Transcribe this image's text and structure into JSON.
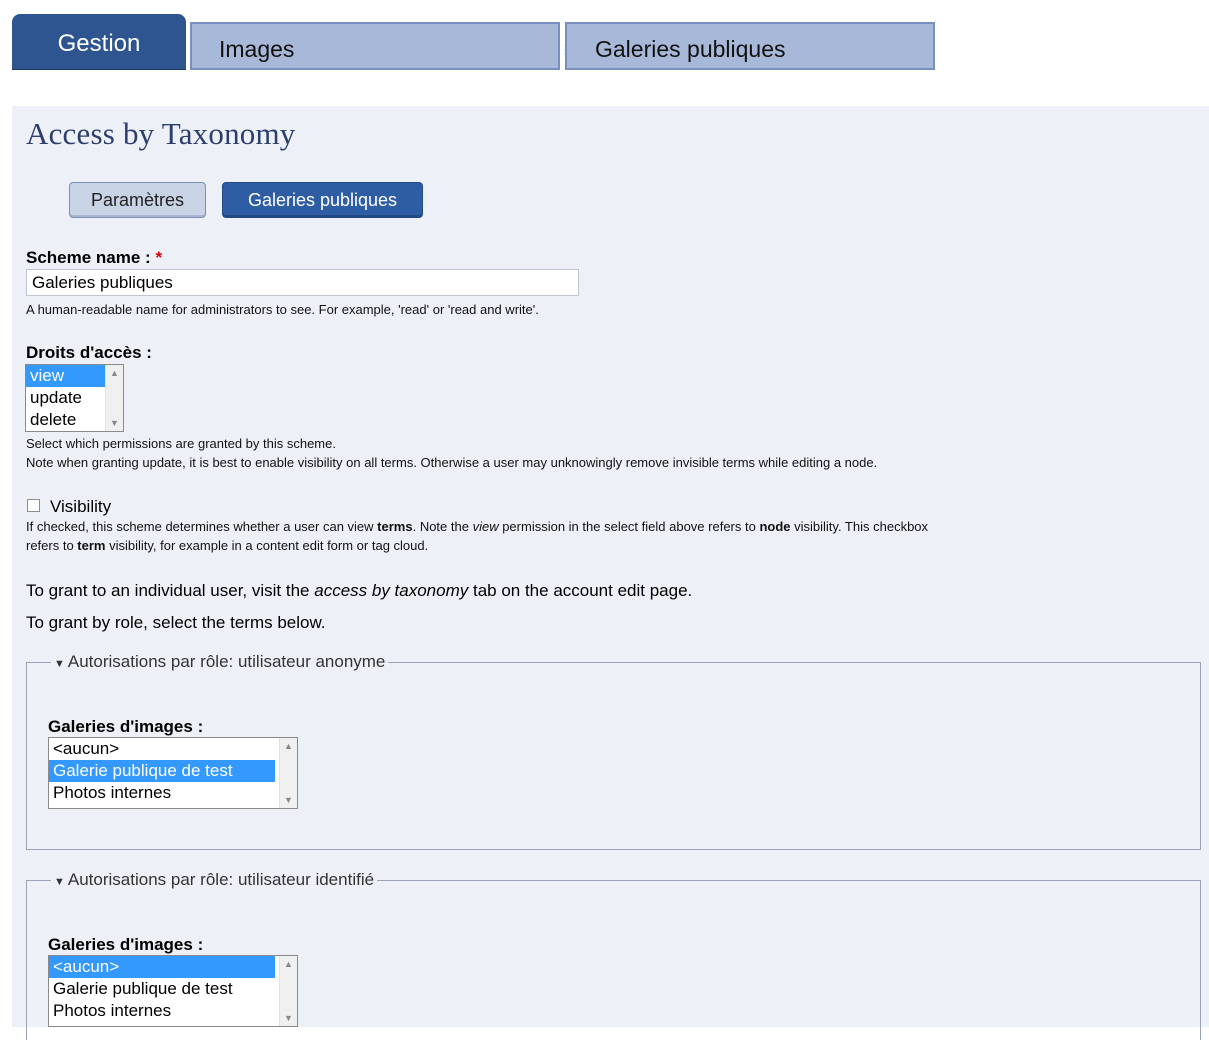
{
  "top_tabs": {
    "active": "Gestion",
    "images": "Images",
    "galleries": "Galeries publiques"
  },
  "page_title": "Access by Taxonomy",
  "local_tabs": {
    "params": "Paramètres",
    "galleries": "Galeries publiques"
  },
  "scheme_name": {
    "label": "Scheme name :",
    "required_mark": "*",
    "value": "Galeries publiques",
    "description": "A human-readable name for administrators to see. For example, 'read' or 'read and write'."
  },
  "access_rights": {
    "label": "Droits d'accès :",
    "options": [
      "view",
      "update",
      "delete"
    ],
    "selected": "view",
    "description_line1": "Select which permissions are granted by this scheme.",
    "description_line2": "Note when granting update, it is best to enable visibility on all terms. Otherwise a user may unknowingly remove invisible terms while editing a node."
  },
  "visibility": {
    "label": "Visibility",
    "checked": false,
    "help_1": "If checked, this scheme determines whether a user can view ",
    "help_terms": "terms",
    "help_2": ". Note the ",
    "help_view": "view",
    "help_3": " permission in the select field above refers to ",
    "help_node": "node",
    "help_4": " visibility. This checkbox",
    "help_5": "refers to ",
    "help_term": "term",
    "help_6": " visibility, for example in a content edit form or tag cloud."
  },
  "grant_user": {
    "prefix": "To grant to an individual user, visit the ",
    "link_text": "access by taxonomy",
    "suffix": " tab on the account edit page."
  },
  "grant_role": "To grant by role, select the terms below.",
  "roles": [
    {
      "legend": "Autorisations par rôle: utilisateur anonyme",
      "field_label": "Galeries d'images :",
      "options": [
        "<aucun>",
        "Galerie publique de test",
        "Photos internes"
      ],
      "selected_index": 1
    },
    {
      "legend": "Autorisations par rôle: utilisateur identifié",
      "field_label": "Galeries d'images :",
      "options": [
        "<aucun>",
        "Galerie publique de test",
        "Photos internes"
      ],
      "selected_index": 0
    }
  ],
  "colors": {
    "tab_active": "#2e5590",
    "tab_inactive": "#a8b8d8",
    "panel_bg": "#edf1f7",
    "selection": "#3399ff",
    "title": "#2c3e6e"
  }
}
